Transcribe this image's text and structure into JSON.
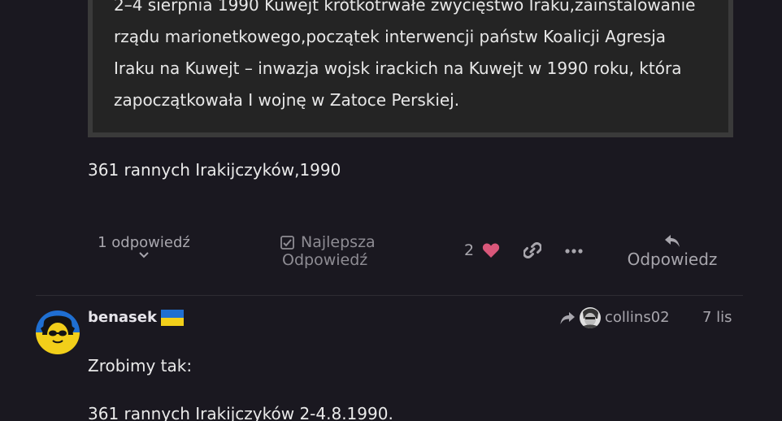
{
  "quote": {
    "lines": [
      "2–4 sierpnia 1990 Kuwejt krótkotrwałe zwycięstwo Iraku,zainstalowanie",
      "rządu marionetkowego,początek interwencji państw Koalicji Agresja",
      "Iraku na Kuwejt – inwazja wojsk irackich na Kuwejt w 1990 roku, która",
      "zapoczątkowała I wojnę w Zatoce Perskiej."
    ]
  },
  "post": {
    "text": "361 rannych Irakijczyków,1990"
  },
  "actions": {
    "replies_label": "1 odpowiedź",
    "best_answer_line1": "Najlepsza",
    "best_answer_line2": "Odpowiedź",
    "like_count": "2",
    "reply_label": "Odpowiedz",
    "heart_color": "#d9577a"
  },
  "next_post": {
    "username": "benasek",
    "reply_to": "collins02",
    "date": "7 lis",
    "line1": "Zrobimy tak:",
    "line2": "361 rannych Irakijczyków 2-4.8.1990."
  },
  "icons": [
    "chevron-down-icon",
    "checkbox-icon",
    "heart-icon",
    "link-icon",
    "more-icon",
    "reply-icon",
    "ukraine-flag-icon",
    "reply-arrow-icon"
  ]
}
